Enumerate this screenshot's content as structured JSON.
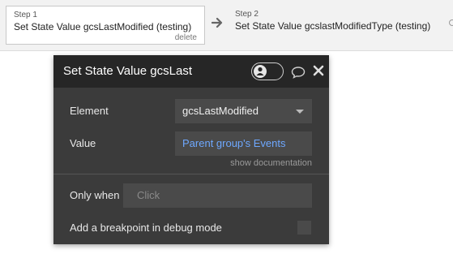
{
  "steps": [
    {
      "number": "Step 1",
      "title": "Set State Value gcsLastModified (testing)",
      "delete_label": "delete"
    },
    {
      "number": "Step 2",
      "title": "Set State Value gcslastModifiedType (testing)"
    }
  ],
  "panel": {
    "title": "Set State Value gcsLastModified (testing)",
    "element_label": "Element",
    "element_value": "gcsLastModified",
    "value_label": "Value",
    "value_value": "Parent group's Events",
    "show_docs": "show documentation",
    "only_when_label": "Only when",
    "only_when_placeholder": "Click",
    "breakpoint_label": "Add a breakpoint in debug mode"
  },
  "icons": {
    "arrow": "arrow-right-icon",
    "toggle_user": "person-icon",
    "comment": "comment-icon",
    "close": "close-icon"
  },
  "colors": {
    "panel_bg": "#3b3b3b",
    "header_bg": "#262626",
    "field_bg": "#4a4a4a",
    "link": "#6ea8ff"
  }
}
